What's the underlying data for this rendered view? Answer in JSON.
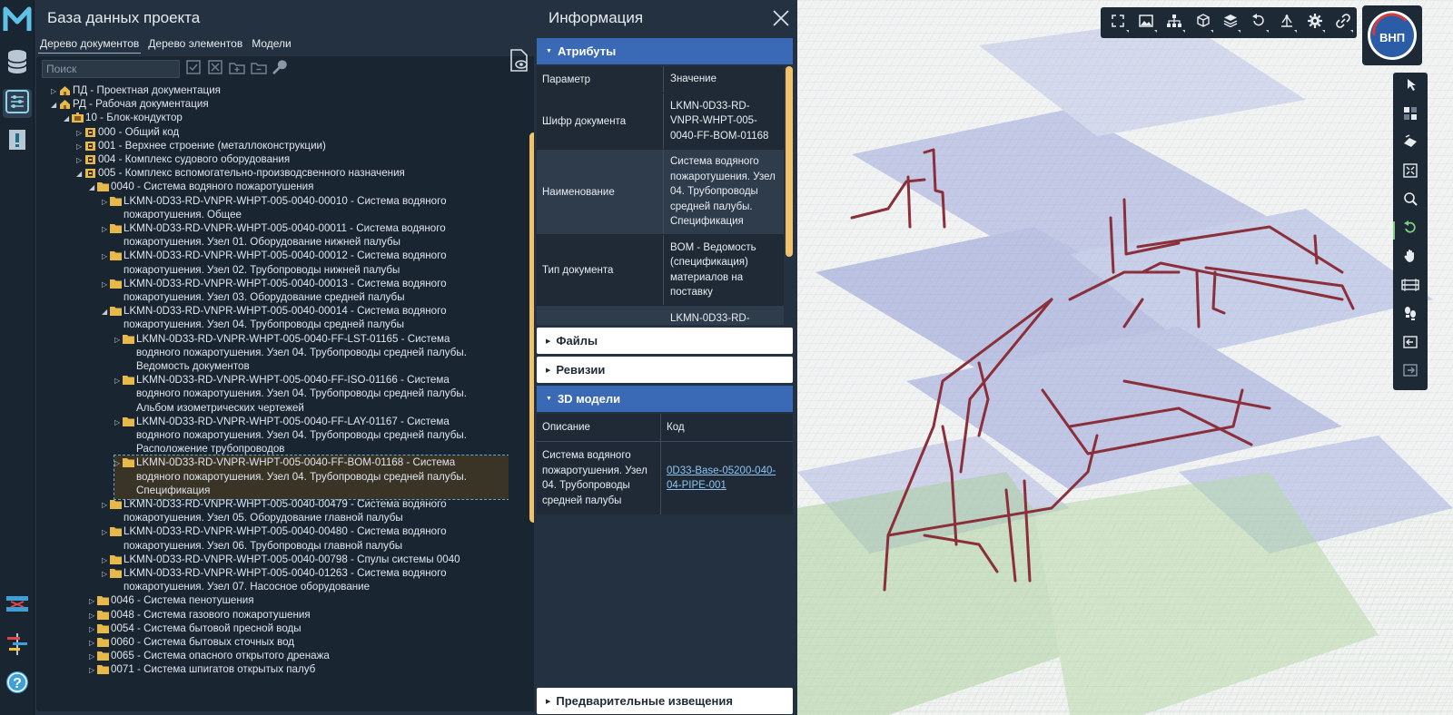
{
  "rail": {
    "logo": "M",
    "buttons": [
      "database-icon",
      "settings-sliders-icon",
      "notice-icon",
      "compare-icon",
      "timeline-icon",
      "help-icon"
    ]
  },
  "db_panel": {
    "title": "База данных проекта",
    "tabs": [
      "Дерево документов",
      "Дерево элементов",
      "Модели"
    ],
    "search_placeholder": "Поиск",
    "tree": [
      {
        "text": "ПД - Проектная документация",
        "level": 0,
        "icon": "home",
        "expanded": false
      },
      {
        "text": "РД - Рабочая документация",
        "level": 0,
        "icon": "home",
        "expanded": true
      },
      {
        "text": "10 - Блок-кондуктор",
        "level": 1,
        "icon": "block",
        "expanded": true
      },
      {
        "text": "000 - Общий код",
        "level": 2,
        "icon": "box",
        "expanded": false
      },
      {
        "text": "001 - Верхнее строение (металлоконструкции)",
        "level": 2,
        "icon": "box",
        "expanded": false
      },
      {
        "text": "004 - Комплекс судового оборудования",
        "level": 2,
        "icon": "box",
        "expanded": false
      },
      {
        "text": "005 - Комплекс вспомогательно-производсвенного назначения",
        "level": 2,
        "icon": "box",
        "expanded": true
      },
      {
        "text": "0040 - Система водяного пожаротушения",
        "level": 3,
        "icon": "folder",
        "expanded": true
      },
      {
        "text": "LKMN-0D33-RD-VNPR-WHPT-005-0040-00010 - Система водяного\nпожаротушения. Общее",
        "level": 4,
        "icon": "folder",
        "expanded": false
      },
      {
        "text": "LKMN-0D33-RD-VNPR-WHPT-005-0040-00011 - Система водяного\nпожаротушения. Узел 01. Оборудование нижней палубы",
        "level": 4,
        "icon": "folder",
        "expanded": false
      },
      {
        "text": "LKMN-0D33-RD-VNPR-WHPT-005-0040-00012 - Система водяного\nпожаротушения. Узел 02. Трубопроводы нижней палубы",
        "level": 4,
        "icon": "folder",
        "expanded": false
      },
      {
        "text": "LKMN-0D33-RD-VNPR-WHPT-005-0040-00013 - Система водяного\nпожаротушения. Узел 03. Оборудование средней палубы",
        "level": 4,
        "icon": "folder",
        "expanded": false
      },
      {
        "text": "LKMN-0D33-RD-VNPR-WHPT-005-0040-00014 - Система водяного\nпожаротушения. Узел 04. Трубопроводы средней палубы",
        "level": 4,
        "icon": "folder",
        "expanded": true
      },
      {
        "text": "LKMN-0D33-RD-VNPR-WHPT-005-0040-FF-LST-01165 - Система\nводяного пожаротушения. Узел 04. Трубопроводы средней палубы.\nВедомость документов",
        "level": 5,
        "icon": "folder",
        "expanded": false
      },
      {
        "text": "LKMN-0D33-RD-VNPR-WHPT-005-0040-FF-ISO-01166 - Система\nводяного пожаротушения. Узел 04. Трубопроводы средней палубы.\nАльбом изометрических чертежей",
        "level": 5,
        "icon": "folder",
        "expanded": false
      },
      {
        "text": "LKMN-0D33-RD-VNPR-WHPT-005-0040-FF-LAY-01167 - Система\nводяного пожаротушения. Узел 04. Трубопроводы средней палубы.\nРасположение трубопроводов",
        "level": 5,
        "icon": "folder",
        "expanded": false
      },
      {
        "text": "LKMN-0D33-RD-VNPR-WHPT-005-0040-FF-BOM-01168 - Система\nводяного пожаротушения. Узел 04. Трубопроводы средней палубы.\nСпецификация",
        "level": 5,
        "icon": "folder",
        "expanded": false,
        "selected": true
      },
      {
        "text": "LKMN-0D33-RD-VNPR-WHPT-005-0040-00479 - Система водяного\nпожаротушения. Узел 05. Оборудование главной палубы",
        "level": 4,
        "icon": "folder",
        "expanded": false
      },
      {
        "text": "LKMN-0D33-RD-VNPR-WHPT-005-0040-00480 - Система водяного\nпожаротушения. Узел 06. Трубопроводы главной палубы",
        "level": 4,
        "icon": "folder",
        "expanded": false
      },
      {
        "text": "LKMN-0D33-RD-VNPR-WHPT-005-0040-00798 - Спулы системы 0040",
        "level": 4,
        "icon": "folder",
        "expanded": false
      },
      {
        "text": "LKMN-0D33-RD-VNPR-WHPT-005-0040-01263 - Система водяного\nпожаротушения. Узел 07. Насосное оборудование",
        "level": 4,
        "icon": "folder",
        "expanded": false
      },
      {
        "text": "0046 - Система пенотушения",
        "level": 3,
        "icon": "folder",
        "expanded": false
      },
      {
        "text": "0048 - Система газового пожаротушения",
        "level": 3,
        "icon": "folder",
        "expanded": false
      },
      {
        "text": "0054 - Система бытовой пресной воды",
        "level": 3,
        "icon": "folder",
        "expanded": false
      },
      {
        "text": "0060 - Система бытовых сточных вод",
        "level": 3,
        "icon": "folder",
        "expanded": false
      },
      {
        "text": "0065 - Система опасного открытого дренажа",
        "level": 3,
        "icon": "folder",
        "expanded": false
      },
      {
        "text": "0071 - Система шпигатов открытых палуб",
        "level": 3,
        "icon": "folder",
        "expanded": false
      }
    ]
  },
  "info_panel": {
    "title": "Информация",
    "sections": {
      "attributes": "Атрибуты",
      "files": "Файлы",
      "revisions": "Ревизии",
      "models": "3D модели",
      "notices": "Предварительные извещения"
    },
    "attributes_table": {
      "headers": [
        "Параметр",
        "Значение"
      ],
      "rows": [
        {
          "param": "Шифр документа",
          "value": "LKMN-0D33-RD-\nVNPR-WHPT-005-\n0040-FF-BOM-01168"
        },
        {
          "param": "Наименование",
          "value": "Система водяного\nпожаротушения. Узел\n04. Трубопроводы\nсредней палубы.\nСпецификация"
        },
        {
          "param": "Тип документа",
          "value": "BOM - Ведомость\n(спецификация)\nматериалов на\nпоставку"
        },
        {
          "param": "",
          "value": "LKMN-0D33-RD-"
        }
      ]
    },
    "models_table": {
      "headers": [
        "Описание",
        "Код"
      ],
      "rows": [
        {
          "description": "Система водяного\nпожаротушения. Узел\n04. Трубопроводы\nсредней палубы",
          "code": "0D33-Base-05200-040-\n04-PIPE-001"
        }
      ]
    }
  },
  "viewport": {
    "brand_text": "ВНП",
    "toolbar": [
      "fullscreen-icon",
      "image-icon",
      "hierarchy-icon",
      "cube-icon",
      "layers-icon",
      "rotate-icon",
      "measure-icon",
      "gear-icon",
      "link-icon"
    ],
    "side_tools": [
      "select-cursor-icon",
      "selection-box-icon",
      "isolate-icon",
      "fit-icon",
      "search-zoom-icon",
      "orbit-icon",
      "pan-hand-icon",
      "section-icon",
      "walk-icon",
      "previous-view-icon",
      "next-view-icon"
    ],
    "colors": {
      "pipe": "#8b2f3a",
      "blue_deck": "#5a6fc0",
      "green_struct": "#6aa85a"
    }
  }
}
